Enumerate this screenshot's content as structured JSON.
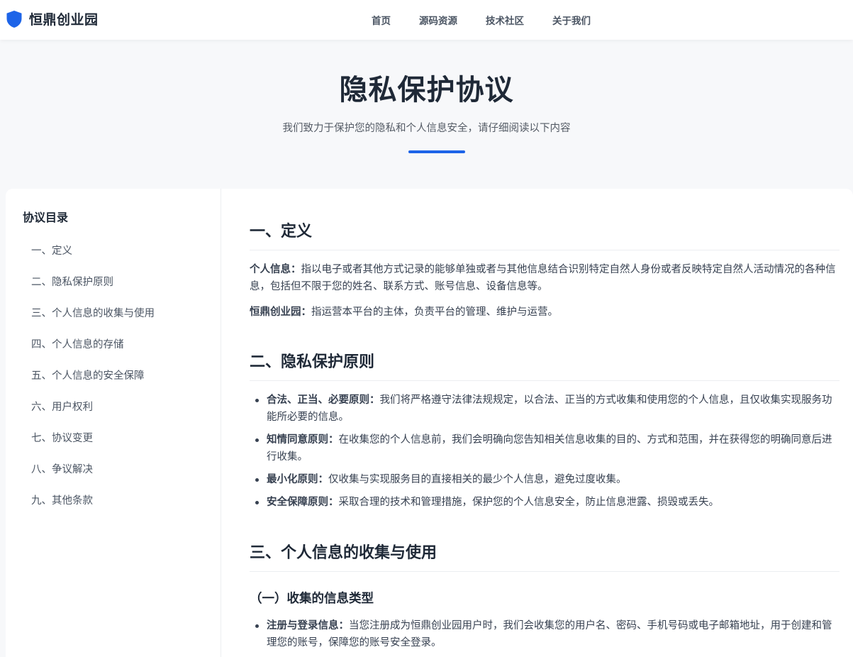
{
  "brand": {
    "name": "恒鼎创业园",
    "icon": "shield-icon",
    "icon_color": "#1d64e8"
  },
  "nav": {
    "items": [
      "首页",
      "源码资源",
      "技术社区",
      "关于我们"
    ]
  },
  "hero": {
    "title": "隐私保护协议",
    "subtitle": "我们致力于保护您的隐私和个人信息安全，请仔细阅读以下内容",
    "accent": "#1d64e8"
  },
  "toc": {
    "title": "协议目录",
    "items": [
      "一、定义",
      "二、隐私保护原则",
      "三、个人信息的收集与使用",
      "四、个人信息的存储",
      "五、个人信息的安全保障",
      "六、用户权利",
      "七、协议变更",
      "八、争议解决",
      "九、其他条款"
    ]
  },
  "sections": {
    "s1": {
      "title": "一、定义",
      "paras": [
        {
          "term": "个人信息：",
          "text": "指以电子或者其他方式记录的能够单独或者与其他信息结合识别特定自然人身份或者反映特定自然人活动情况的各种信息，包括但不限于您的姓名、联系方式、账号信息、设备信息等。"
        },
        {
          "term": "恒鼎创业园：",
          "text": "指运营本平台的主体，负责平台的管理、维护与运营。"
        }
      ]
    },
    "s2": {
      "title": "二、隐私保护原则",
      "items": [
        {
          "term": "合法、正当、必要原则：",
          "text": "我们将严格遵守法律法规规定，以合法、正当的方式收集和使用您的个人信息，且仅收集实现服务功能所必要的信息。"
        },
        {
          "term": "知情同意原则：",
          "text": "在收集您的个人信息前，我们会明确向您告知相关信息收集的目的、方式和范围，并在获得您的明确同意后进行收集。"
        },
        {
          "term": "最小化原则：",
          "text": "仅收集与实现服务目的直接相关的最少个人信息，避免过度收集。"
        },
        {
          "term": "安全保障原则：",
          "text": "采取合理的技术和管理措施，保护您的个人信息安全，防止信息泄露、损毁或丢失。"
        }
      ]
    },
    "s3": {
      "title": "三、个人信息的收集与使用",
      "sub1": {
        "title": "（一）收集的信息类型",
        "items": [
          {
            "term": "注册与登录信息：",
            "text": "当您注册成为恒鼎创业园用户时，我们会收集您的用户名、密码、手机号码或电子邮箱地址，用于创建和管理您的账号，保障您的账号安全登录。"
          }
        ]
      }
    }
  }
}
